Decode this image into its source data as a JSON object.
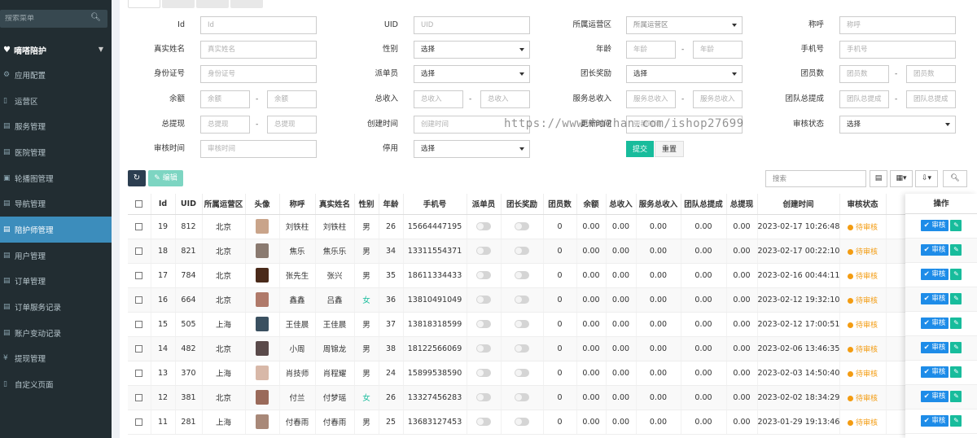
{
  "sidebar": {
    "search_placeholder": "搜索菜单",
    "brand": "嘀嗒陪护",
    "items": [
      {
        "icon": "gear-icon",
        "glyph": "⚙",
        "label": "应用配置"
      },
      {
        "icon": "map-icon",
        "glyph": "▯",
        "label": "运营区"
      },
      {
        "icon": "list-icon",
        "glyph": "▤",
        "label": "服务管理"
      },
      {
        "icon": "hospital-icon",
        "glyph": "▤",
        "label": "医院管理"
      },
      {
        "icon": "image-icon",
        "glyph": "▣",
        "label": "轮播图管理"
      },
      {
        "icon": "nav-icon",
        "glyph": "▤",
        "label": "导航管理"
      },
      {
        "icon": "caregiver-icon",
        "glyph": "▤",
        "label": "陪护师管理",
        "active": true
      },
      {
        "icon": "user-icon",
        "glyph": "▤",
        "label": "用户管理"
      },
      {
        "icon": "order-icon",
        "glyph": "▤",
        "label": "订单管理"
      },
      {
        "icon": "record-icon",
        "glyph": "▤",
        "label": "订单服务记录"
      },
      {
        "icon": "account-icon",
        "glyph": "▤",
        "label": "账户变动记录"
      },
      {
        "icon": "yen-icon",
        "glyph": "¥",
        "label": "提现管理"
      },
      {
        "icon": "page-icon",
        "glyph": "▯",
        "label": "自定义页面"
      }
    ]
  },
  "filter": {
    "id_label": "Id",
    "id_ph": "Id",
    "uid_label": "UID",
    "uid_ph": "UID",
    "region_label": "所属运营区",
    "region_value": "所属运营区",
    "nick_label": "称呼",
    "nick_ph": "称呼",
    "realname_label": "真实姓名",
    "realname_ph": "真实姓名",
    "gender_label": "性别",
    "gender_value": "选择",
    "age_label": "年龄",
    "age_ph1": "年龄",
    "age_ph2": "年龄",
    "phone_label": "手机号",
    "phone_ph": "手机号",
    "idcard_label": "身份证号",
    "idcard_ph": "身份证号",
    "dispatcher_label": "派单员",
    "dispatcher_value": "选择",
    "leader_label": "团长奖励",
    "leader_value": "选择",
    "members_label": "团员数",
    "members_ph1": "团员数",
    "members_ph2": "团员数",
    "balance_label": "余额",
    "balance_ph1": "余额",
    "balance_ph2": "余额",
    "income_label": "总收入",
    "income_ph1": "总收入",
    "income_ph2": "总收入",
    "svc_income_label": "服务总收入",
    "svc_income_ph1": "服务总收入",
    "svc_income_ph2": "服务总收入",
    "team_withdraw_label": "团队总提成",
    "team_withdraw_ph1": "团队总提成",
    "team_withdraw_ph2": "团队总提成",
    "withdraw_label": "总提现",
    "withdraw_ph1": "总提现",
    "withdraw_ph2": "总提现",
    "ctime_label": "创建时间",
    "ctime_ph": "创建时间",
    "utime_label": "更新时间",
    "utime_ph": "更新时间",
    "status_label": "审核状态",
    "status_value": "选择",
    "rtime_label": "审核时间",
    "rtime_ph": "审核时间",
    "stop_label": "停用",
    "stop_value": "选择",
    "submit": "提交",
    "reset": "重置",
    "watermark": "https://www.huzhan.com/ishop27699"
  },
  "toolbar": {
    "edit": "✎ 编辑",
    "search_ph": "搜索"
  },
  "table": {
    "headers": [
      "Id",
      "UID",
      "所属运营区",
      "头像",
      "称呼",
      "真实姓名",
      "性别",
      "年龄",
      "手机号",
      "派单员",
      "团长奖励",
      "团员数",
      "余额",
      "总收入",
      "服务总收入",
      "团队总提成",
      "总提现",
      "创建时间",
      "审核状态",
      "停",
      "操作"
    ],
    "status_text": "待审核",
    "review_btn": "审核",
    "rows": [
      {
        "id": "19",
        "uid": "812",
        "region": "北京",
        "avatar": "#c9a48a",
        "nick": "刘铁柱",
        "name": "刘铁柱",
        "gender": "男",
        "age": "26",
        "phone": "15664447195",
        "members": "0",
        "balance": "0.00",
        "income": "0.00",
        "svc": "0.00",
        "team": "0.00",
        "withdraw": "0.00",
        "ctime": "2023-02-17 10:26:48"
      },
      {
        "id": "18",
        "uid": "821",
        "region": "北京",
        "avatar": "#8a7a70",
        "nick": "焦乐",
        "name": "焦乐乐",
        "gender": "男",
        "age": "34",
        "phone": "13311554371",
        "members": "0",
        "balance": "0.00",
        "income": "0.00",
        "svc": "0.00",
        "team": "0.00",
        "withdraw": "0.00",
        "ctime": "2023-02-17 00:22:10"
      },
      {
        "id": "17",
        "uid": "784",
        "region": "北京",
        "avatar": "#4a2a1a",
        "nick": "张先生",
        "name": "张兴",
        "gender": "男",
        "age": "35",
        "phone": "18611334433",
        "members": "0",
        "balance": "0.00",
        "income": "0.00",
        "svc": "0.00",
        "team": "0.00",
        "withdraw": "0.00",
        "ctime": "2023-02-16 00:44:11"
      },
      {
        "id": "16",
        "uid": "664",
        "region": "北京",
        "avatar": "#b07a6a",
        "nick": "鑫鑫",
        "name": "吕鑫",
        "gender": "女",
        "age": "36",
        "phone": "13810491049",
        "members": "0",
        "balance": "0.00",
        "income": "0.00",
        "svc": "0.00",
        "team": "0.00",
        "withdraw": "0.00",
        "ctime": "2023-02-12 19:32:10"
      },
      {
        "id": "15",
        "uid": "505",
        "region": "上海",
        "avatar": "#3a5060",
        "nick": "王佳晨",
        "name": "王佳晨",
        "gender": "男",
        "age": "37",
        "phone": "13818318599",
        "members": "0",
        "balance": "0.00",
        "income": "0.00",
        "svc": "0.00",
        "team": "0.00",
        "withdraw": "0.00",
        "ctime": "2023-02-12 17:00:51"
      },
      {
        "id": "14",
        "uid": "482",
        "region": "北京",
        "avatar": "#5a4a4a",
        "nick": "小周",
        "name": "周锦龙",
        "gender": "男",
        "age": "38",
        "phone": "18122566069",
        "members": "0",
        "balance": "0.00",
        "income": "0.00",
        "svc": "0.00",
        "team": "0.00",
        "withdraw": "0.00",
        "ctime": "2023-02-06 13:46:35"
      },
      {
        "id": "13",
        "uid": "370",
        "region": "上海",
        "avatar": "#d8b8a8",
        "nick": "肖技师",
        "name": "肖程耀",
        "gender": "男",
        "age": "24",
        "phone": "15899538590",
        "members": "0",
        "balance": "0.00",
        "income": "0.00",
        "svc": "0.00",
        "team": "0.00",
        "withdraw": "0.00",
        "ctime": "2023-02-03 14:50:40"
      },
      {
        "id": "12",
        "uid": "381",
        "region": "北京",
        "avatar": "#9a6a5a",
        "nick": "付兰",
        "name": "付梦瑶",
        "gender": "女",
        "age": "26",
        "phone": "13327456283",
        "members": "0",
        "balance": "0.00",
        "income": "0.00",
        "svc": "0.00",
        "team": "0.00",
        "withdraw": "0.00",
        "ctime": "2023-02-02 18:34:29"
      },
      {
        "id": "11",
        "uid": "281",
        "region": "上海",
        "avatar": "#a88878",
        "nick": "付春雨",
        "name": "付春雨",
        "gender": "男",
        "age": "25",
        "phone": "13683127453",
        "members": "0",
        "balance": "0.00",
        "income": "0.00",
        "svc": "0.00",
        "team": "0.00",
        "withdraw": "0.00",
        "ctime": "2023-01-29 19:13:46"
      }
    ]
  }
}
